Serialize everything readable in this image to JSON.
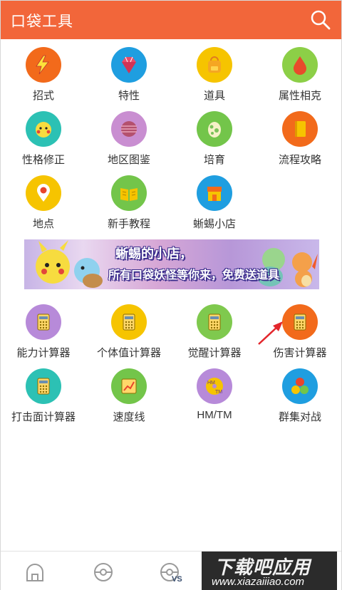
{
  "header": {
    "title": "口袋工具"
  },
  "grid1": [
    {
      "label": "招式",
      "color": "#f26a1b",
      "icon": "lightning-icon"
    },
    {
      "label": "特性",
      "color": "#1f9ee0",
      "icon": "gem-icon"
    },
    {
      "label": "道具",
      "color": "#f6c400",
      "icon": "bag-icon"
    },
    {
      "label": "属性相克",
      "color": "#8ccf47",
      "icon": "drop-icon"
    },
    {
      "label": "性格修正",
      "color": "#2cc1b4",
      "icon": "pikachu-icon"
    },
    {
      "label": "地区图鉴",
      "color": "#c98ed1",
      "icon": "ball-icon"
    },
    {
      "label": "培育",
      "color": "#73c54a",
      "icon": "egg-icon"
    },
    {
      "label": "流程攻略",
      "color": "#f26a1b",
      "icon": "book-icon"
    },
    {
      "label": "地点",
      "color": "#f6c400",
      "icon": "location-pin-icon"
    },
    {
      "label": "新手教程",
      "color": "#73c54a",
      "icon": "open-book-icon"
    },
    {
      "label": "蜥蜴小店",
      "color": "#1f9ee0",
      "icon": "shop-icon"
    }
  ],
  "banner": {
    "line1": "蜥蜴的小店，",
    "line2": "所有口袋妖怪等你来，免费送道具"
  },
  "grid2": [
    {
      "label": "能力计算器",
      "color": "#b78ad9",
      "icon": "calculator-icon"
    },
    {
      "label": "个体值计算器",
      "color": "#f6c400",
      "icon": "calculator-icon"
    },
    {
      "label": "觉醒计算器",
      "color": "#7fc94e",
      "icon": "calculator-icon"
    },
    {
      "label": "伤害计算器",
      "color": "#f26a1b",
      "icon": "calculator-icon"
    },
    {
      "label": "打击面计算器",
      "color": "#2cc1b4",
      "icon": "calculator-icon"
    },
    {
      "label": "速度线",
      "color": "#73c54a",
      "icon": "chart-icon"
    },
    {
      "label": "HM/TM",
      "color": "#b78ad9",
      "icon": "hm-tm-disc-icon"
    },
    {
      "label": "群集对战",
      "color": "#1f9ee0",
      "icon": "team-icon"
    }
  ],
  "watermark": {
    "cn": "下载吧应用",
    "url": "www.xiazaiiiao.com"
  }
}
